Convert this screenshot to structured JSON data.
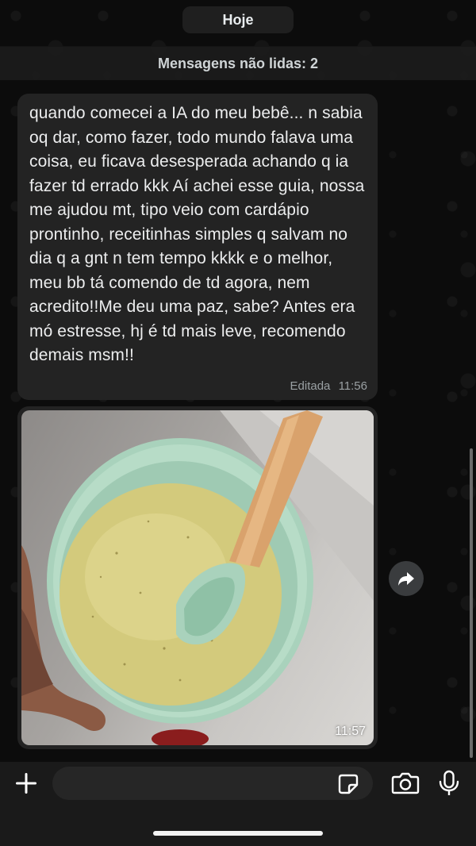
{
  "header": {
    "day_chip": "Hoje",
    "unread_banner": "Mensagens não lidas: 2"
  },
  "messages": [
    {
      "type": "text",
      "text": "quando comecei a IA do meu bebê... n sabia oq dar, como fazer, todo mundo falava uma coisa, eu ficava desesperada achando q ia fazer td errado kkk Aí achei esse guia, nossa me ajudou mt, tipo veio com cardápio prontinho, receitinhas simples q salvam no dia q a gnt n tem tempo kkkk e o melhor, meu bb tá comendo de td agora, nem acredito!!Me deu uma paz, sabe? Antes era mó estresse, hj é td mais leve, recomendo demais msm!!",
      "edited_label": "Editada",
      "time": "11:56"
    },
    {
      "type": "image",
      "image_description_icon": "baby-food-bowl-photo",
      "time": "11:57"
    }
  ],
  "actions": {
    "forward_icon": "forward-arrow-icon"
  },
  "composer": {
    "plus_icon": "plus-icon",
    "sticker_icon": "sticker-icon",
    "camera_icon": "camera-icon",
    "mic_icon": "microphone-icon",
    "text_value": ""
  },
  "colors": {
    "background": "#0b0b0b",
    "bubble": "#232323",
    "bubble_text": "#ecedee",
    "meta_text": "#9aa0a3",
    "bowl_green": "#a9d2bc",
    "soup": "#d3ca7c",
    "spoon_wood": "#d9a26c"
  }
}
